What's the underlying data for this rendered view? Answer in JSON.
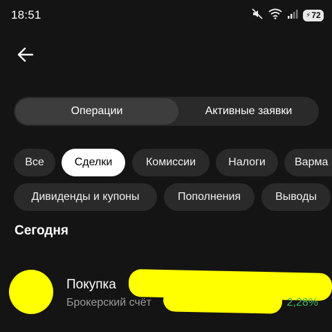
{
  "status_bar": {
    "time": "18:51",
    "icons": [
      "mute-icon",
      "wifi-icon",
      "signal-icon"
    ],
    "battery": "72"
  },
  "header": {
    "back_icon": "arrow-left-icon"
  },
  "tabs": [
    {
      "label": "Операции",
      "active": true
    },
    {
      "label": "Активные заявки",
      "active": false
    }
  ],
  "filters": {
    "row1": [
      {
        "label": "Все",
        "selected": false
      },
      {
        "label": "Сделки",
        "selected": true
      },
      {
        "label": "Комиссии",
        "selected": false
      },
      {
        "label": "Налоги",
        "selected": false
      },
      {
        "label": "Варма",
        "selected": false
      }
    ],
    "row2": [
      {
        "label": "Дивиденды и купоны",
        "selected": false
      },
      {
        "label": "Пополнения",
        "selected": false
      },
      {
        "label": "Выводы",
        "selected": false
      }
    ]
  },
  "section": {
    "title": "Сегодня"
  },
  "operation": {
    "title": "Покупка",
    "subtitle": "Брокерский счёт",
    "percent": "2,28%"
  },
  "colors": {
    "background": "#141414",
    "highlight": "#ffff00",
    "positive": "#3fba5c"
  }
}
